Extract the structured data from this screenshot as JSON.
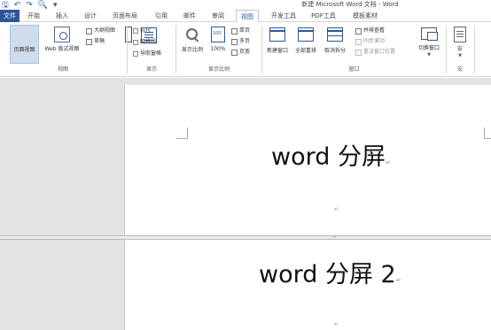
{
  "window": {
    "title": "新建 Microsoft Word 文档 - Word"
  },
  "quick_access": {
    "icons": [
      "save-icon",
      "undo-icon",
      "redo-icon",
      "print-preview-icon",
      "customize-icon"
    ],
    "save_glyph": "🖫",
    "undo_glyph": "↶",
    "redo_glyph": "↷",
    "preview_glyph": "🔍",
    "customize_glyph": "▾"
  },
  "tabs": [
    {
      "label": "文件"
    },
    {
      "label": "开始"
    },
    {
      "label": "插入"
    },
    {
      "label": "设计"
    },
    {
      "label": "页面布局"
    },
    {
      "label": "引用"
    },
    {
      "label": "邮件"
    },
    {
      "label": "审阅"
    },
    {
      "label": "视图"
    },
    {
      "label": "开发工具"
    },
    {
      "label": "PDF工具"
    },
    {
      "label": "模板素材"
    }
  ],
  "ribbon": {
    "views": {
      "label": "视图",
      "read_mode": "阅读\n视图",
      "print_layout": "页面视图",
      "web_layout": "Web 版式视图",
      "outline": "大纲视图",
      "draft": "草稿"
    },
    "show": {
      "label": "显示",
      "ruler": "标尺",
      "gridlines": "网格线",
      "nav_pane": "导航窗格"
    },
    "zoom": {
      "label": "显示比例",
      "zoom": "显示比例",
      "hundred": "100%",
      "one_page": "单页",
      "multi_page": "多页",
      "page_width": "页宽"
    },
    "window": {
      "label": "窗口",
      "new_window": "新建窗口",
      "arrange_all": "全部重排",
      "split": "取消拆分",
      "side_by_side": "并排查看",
      "sync_scroll": "同步滚动",
      "reset_position": "重设窗口位置",
      "switch_windows": "切换窗口"
    },
    "macros": {
      "label": "宏",
      "macros": "宏"
    }
  },
  "document": {
    "top_pane_text": "word 分屏",
    "bottom_pane_text": "word 分屏 2",
    "paragraph_mark": "↵"
  }
}
